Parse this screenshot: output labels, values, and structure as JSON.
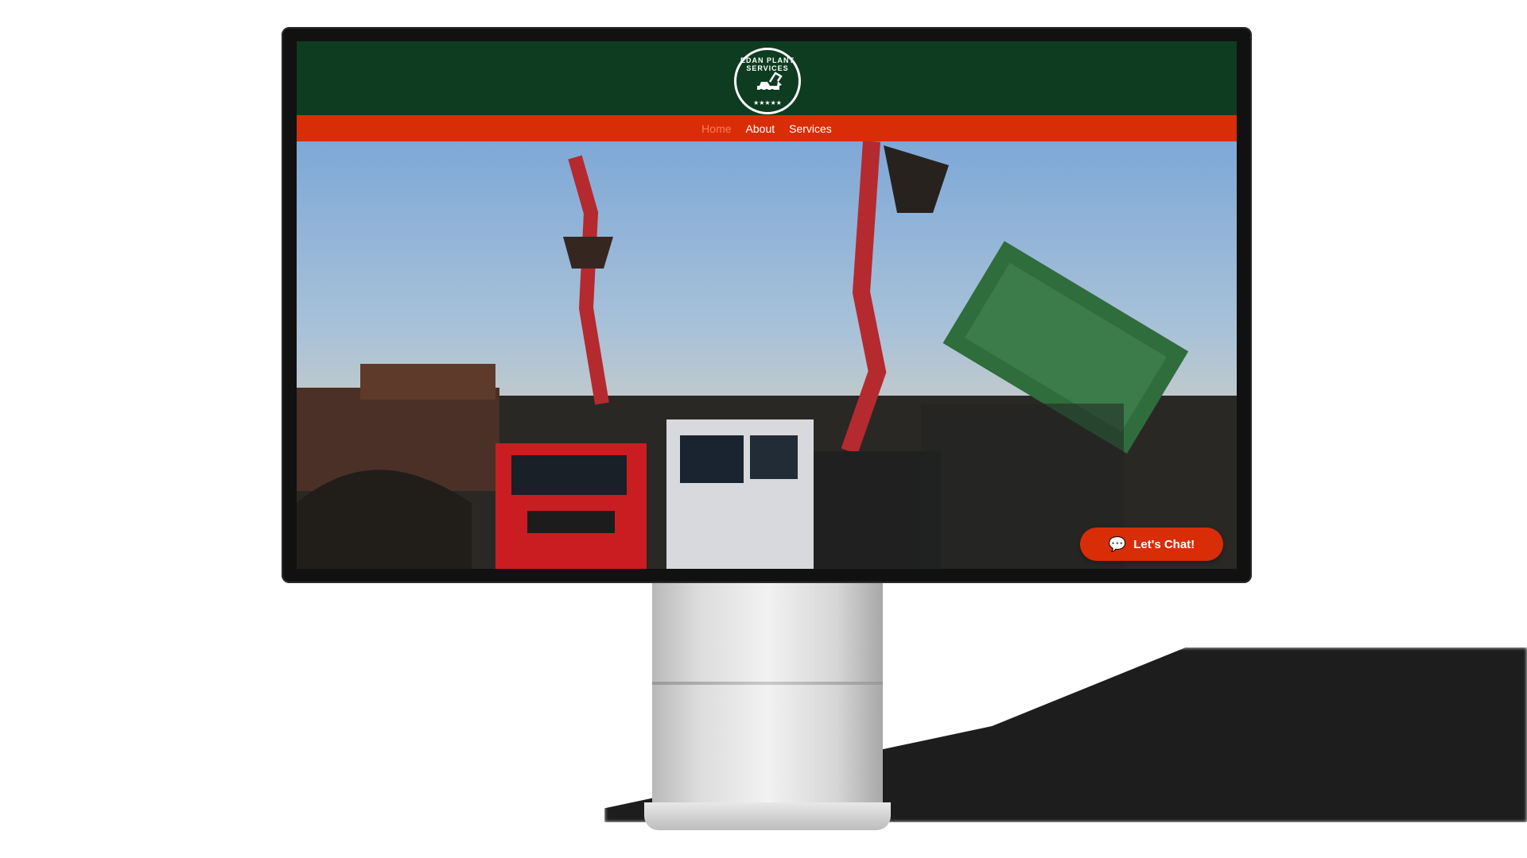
{
  "site": {
    "logo": {
      "ring_text": "EDAN PLANT SERVICES",
      "stars": "★★★★★",
      "icon": "excavator-icon"
    },
    "nav": [
      {
        "label": "Home",
        "active": true
      },
      {
        "label": "About",
        "active": false
      },
      {
        "label": "Services",
        "active": false
      }
    ],
    "chat": {
      "label": "Let's Chat!",
      "icon": "chat-bubble-icon"
    }
  },
  "colors": {
    "header_green": "#0e3c21",
    "nav_red": "#d92d08",
    "nav_active": "#ff7a55",
    "chat_red": "#d92d08"
  }
}
